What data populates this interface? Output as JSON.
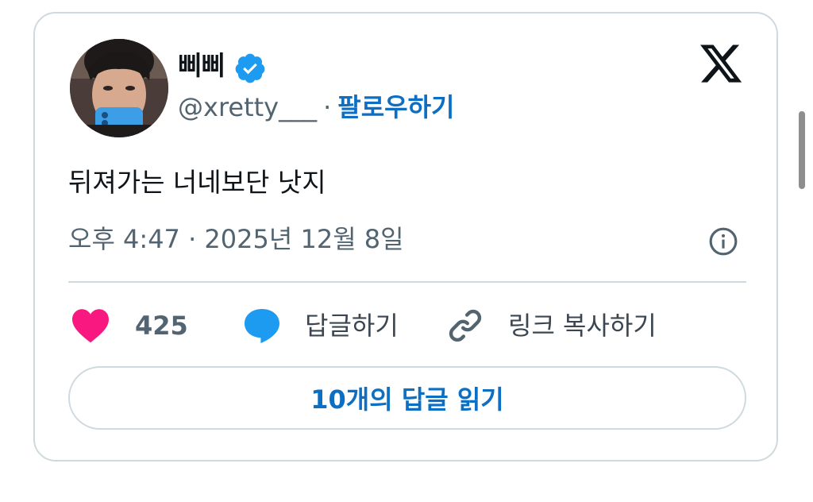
{
  "author": {
    "display_name": "삐삐",
    "handle": "@xretty___",
    "separator": "·",
    "follow_label": "팔로우하기",
    "verified_icon": "verified-badge-icon",
    "verified_color": "#1d9bf0"
  },
  "tweet": {
    "text": "뒤져가는 너네보단 낫지",
    "timestamp": "오후 4:47 · 2025년 12월 8일"
  },
  "actions": {
    "like_count": "425",
    "reply_label": "답글하기",
    "copy_link_label": "링크 복사하기"
  },
  "read_replies_label": "10개의 답글 읽기",
  "colors": {
    "accent": "#0c6fc4",
    "heart": "#f91880",
    "reply_bubble": "#1d9bf0",
    "secondary_text": "#536471",
    "border": "#cfd9de"
  },
  "icons": {
    "brand": "x-logo-icon",
    "info": "info-icon",
    "like": "heart-icon",
    "reply": "speech-bubble-icon",
    "copy": "link-icon"
  }
}
